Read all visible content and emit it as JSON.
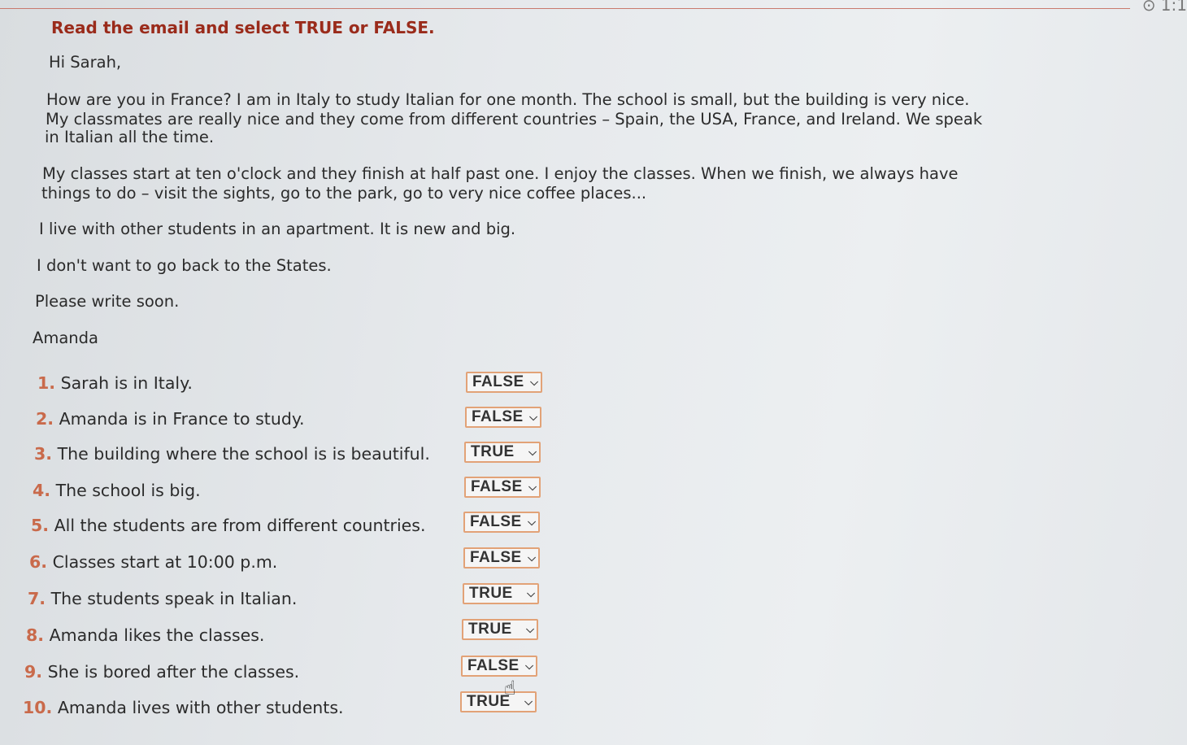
{
  "header": {
    "instructions": "Read the email and select TRUE or FALSE.",
    "corner": "⊙ 1:1"
  },
  "email": {
    "greeting": "Hi Sarah,",
    "p1": [
      "How are you in France? I am in Italy to study Italian for one month. The school is small, but the building is very nice.",
      "My classmates are really nice and they come from different countries – Spain, the USA, France, and Ireland. We speak",
      "in Italian all the time."
    ],
    "p2": [
      "My classes start at ten o'clock and they finish at half past one. I enjoy the classes. When we finish, we always have",
      "things to do – visit the sights, go to the park, go to very nice coffee places..."
    ],
    "p3": "I live with other students in an apartment. It is new and big.",
    "p4": "I don't want to go back to the States.",
    "p5": "Please write soon.",
    "signature": "Amanda"
  },
  "questions": [
    {
      "num": "1.",
      "text": "Sarah is in Italy.",
      "answer": "FALSE"
    },
    {
      "num": "2.",
      "text": "Amanda is in France to study.",
      "answer": "FALSE"
    },
    {
      "num": "3.",
      "text": "The building where the school is is beautiful.",
      "answer": "TRUE"
    },
    {
      "num": "4.",
      "text": "The school is big.",
      "answer": "FALSE"
    },
    {
      "num": "5.",
      "text": "All the students are from different countries.",
      "answer": "FALSE"
    },
    {
      "num": "6.",
      "text": "Classes start at 10:00 p.m.",
      "answer": "FALSE"
    },
    {
      "num": "7.",
      "text": "The students speak in Italian.",
      "answer": "TRUE"
    },
    {
      "num": "8.",
      "text": "Amanda likes the classes.",
      "answer": "TRUE"
    },
    {
      "num": "9.",
      "text": "She is bored after the classes.",
      "answer": "FALSE"
    },
    {
      "num": "10.",
      "text": "Amanda lives with other students.",
      "answer": "TRUE"
    }
  ],
  "icons": {
    "dropdown": "chevron-down-icon",
    "cursor": "hand-pointer-icon"
  }
}
